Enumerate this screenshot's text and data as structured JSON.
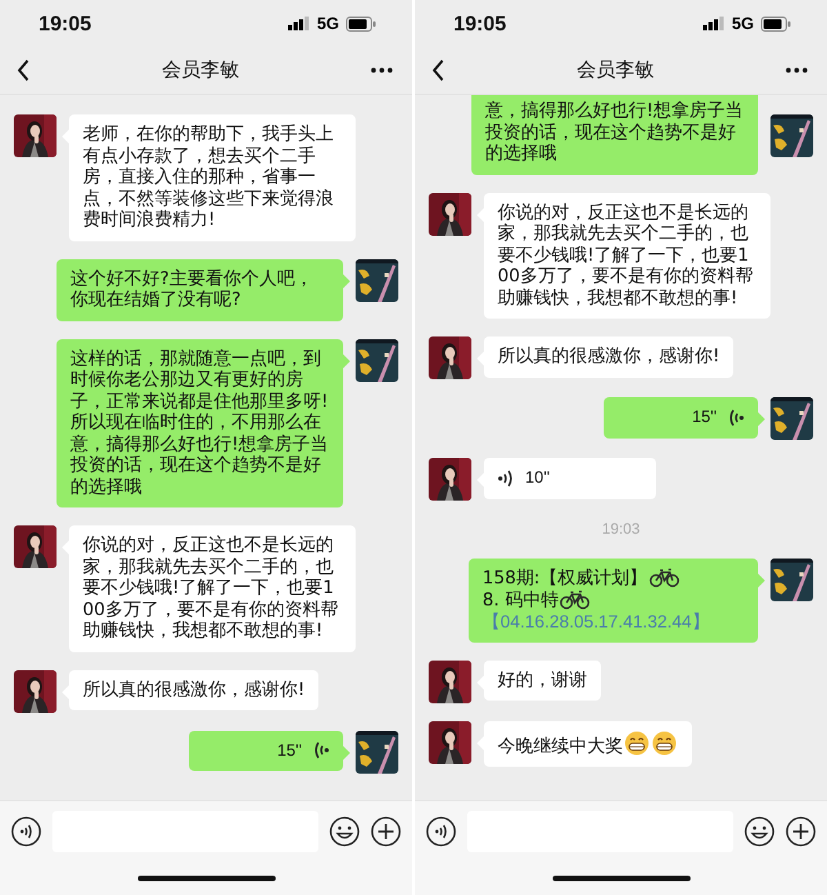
{
  "screens": [
    {
      "status": {
        "time": "19:05",
        "network": "5G"
      },
      "title": "会员李敏",
      "messages": [
        {
          "kind": "text",
          "from_me": false,
          "text": "老师，在你的帮助下，我手头上有点小存款了，想去买个二手房，直接入住的那种，省事一点，不然等装修这些下来觉得浪费时间浪费精力!"
        },
        {
          "kind": "text",
          "from_me": true,
          "text": "这个好不好?主要看你个人吧，你现在结婚了没有呢?"
        },
        {
          "kind": "text",
          "from_me": true,
          "text": "这样的话，那就随意一点吧，到时候你老公那边又有更好的房子，正常来说都是住他那里多呀!所以现在临时住的，不用那么在意，搞得那么好也行!想拿房子当投资的话，现在这个趋势不是好的选择哦"
        },
        {
          "kind": "text",
          "from_me": false,
          "text": "你说的对，反正这也不是长远的家，那我就先去买个二手的，也要不少钱哦!了解了一下，也要100多万了，要不是有你的资料帮助赚钱快，我想都不敢想的事!"
        },
        {
          "kind": "text",
          "from_me": false,
          "text": "所以真的很感激你，感谢你!"
        },
        {
          "kind": "voice",
          "from_me": true,
          "duration": "15''"
        }
      ]
    },
    {
      "status": {
        "time": "19:05",
        "network": "5G"
      },
      "title": "会员李敏",
      "messages": [
        {
          "kind": "text",
          "from_me": true,
          "continued": true,
          "text": "意，搞得那么好也行!想拿房子当投资的话，现在这个趋势不是好的选择哦"
        },
        {
          "kind": "text",
          "from_me": false,
          "text": "你说的对，反正这也不是长远的家，那我就先去买个二手的，也要不少钱哦!了解了一下，也要100多万了，要不是有你的资料帮助赚钱快，我想都不敢想的事!"
        },
        {
          "kind": "text",
          "from_me": false,
          "text": "所以真的很感激你，感谢你!"
        },
        {
          "kind": "voice",
          "from_me": true,
          "duration": "15''"
        },
        {
          "kind": "voice",
          "from_me": false,
          "duration": "10''"
        },
        {
          "kind": "time",
          "text": "19:03"
        },
        {
          "kind": "rich",
          "from_me": true,
          "segments": [
            {
              "kind": "text",
              "text": "158期:【权威计划】"
            },
            {
              "kind": "bike"
            },
            {
              "kind": "text",
              "text": "8. 码中特"
            },
            {
              "kind": "bike"
            },
            {
              "kind": "link",
              "text": "【04.16.28.05.17.41.32.44】"
            }
          ]
        },
        {
          "kind": "text",
          "from_me": false,
          "text": "好的，谢谢"
        },
        {
          "kind": "rich",
          "from_me": false,
          "segments": [
            {
              "kind": "text",
              "text": "今晚继续中大奖"
            },
            {
              "kind": "grin"
            },
            {
              "kind": "grin"
            }
          ]
        }
      ]
    }
  ]
}
